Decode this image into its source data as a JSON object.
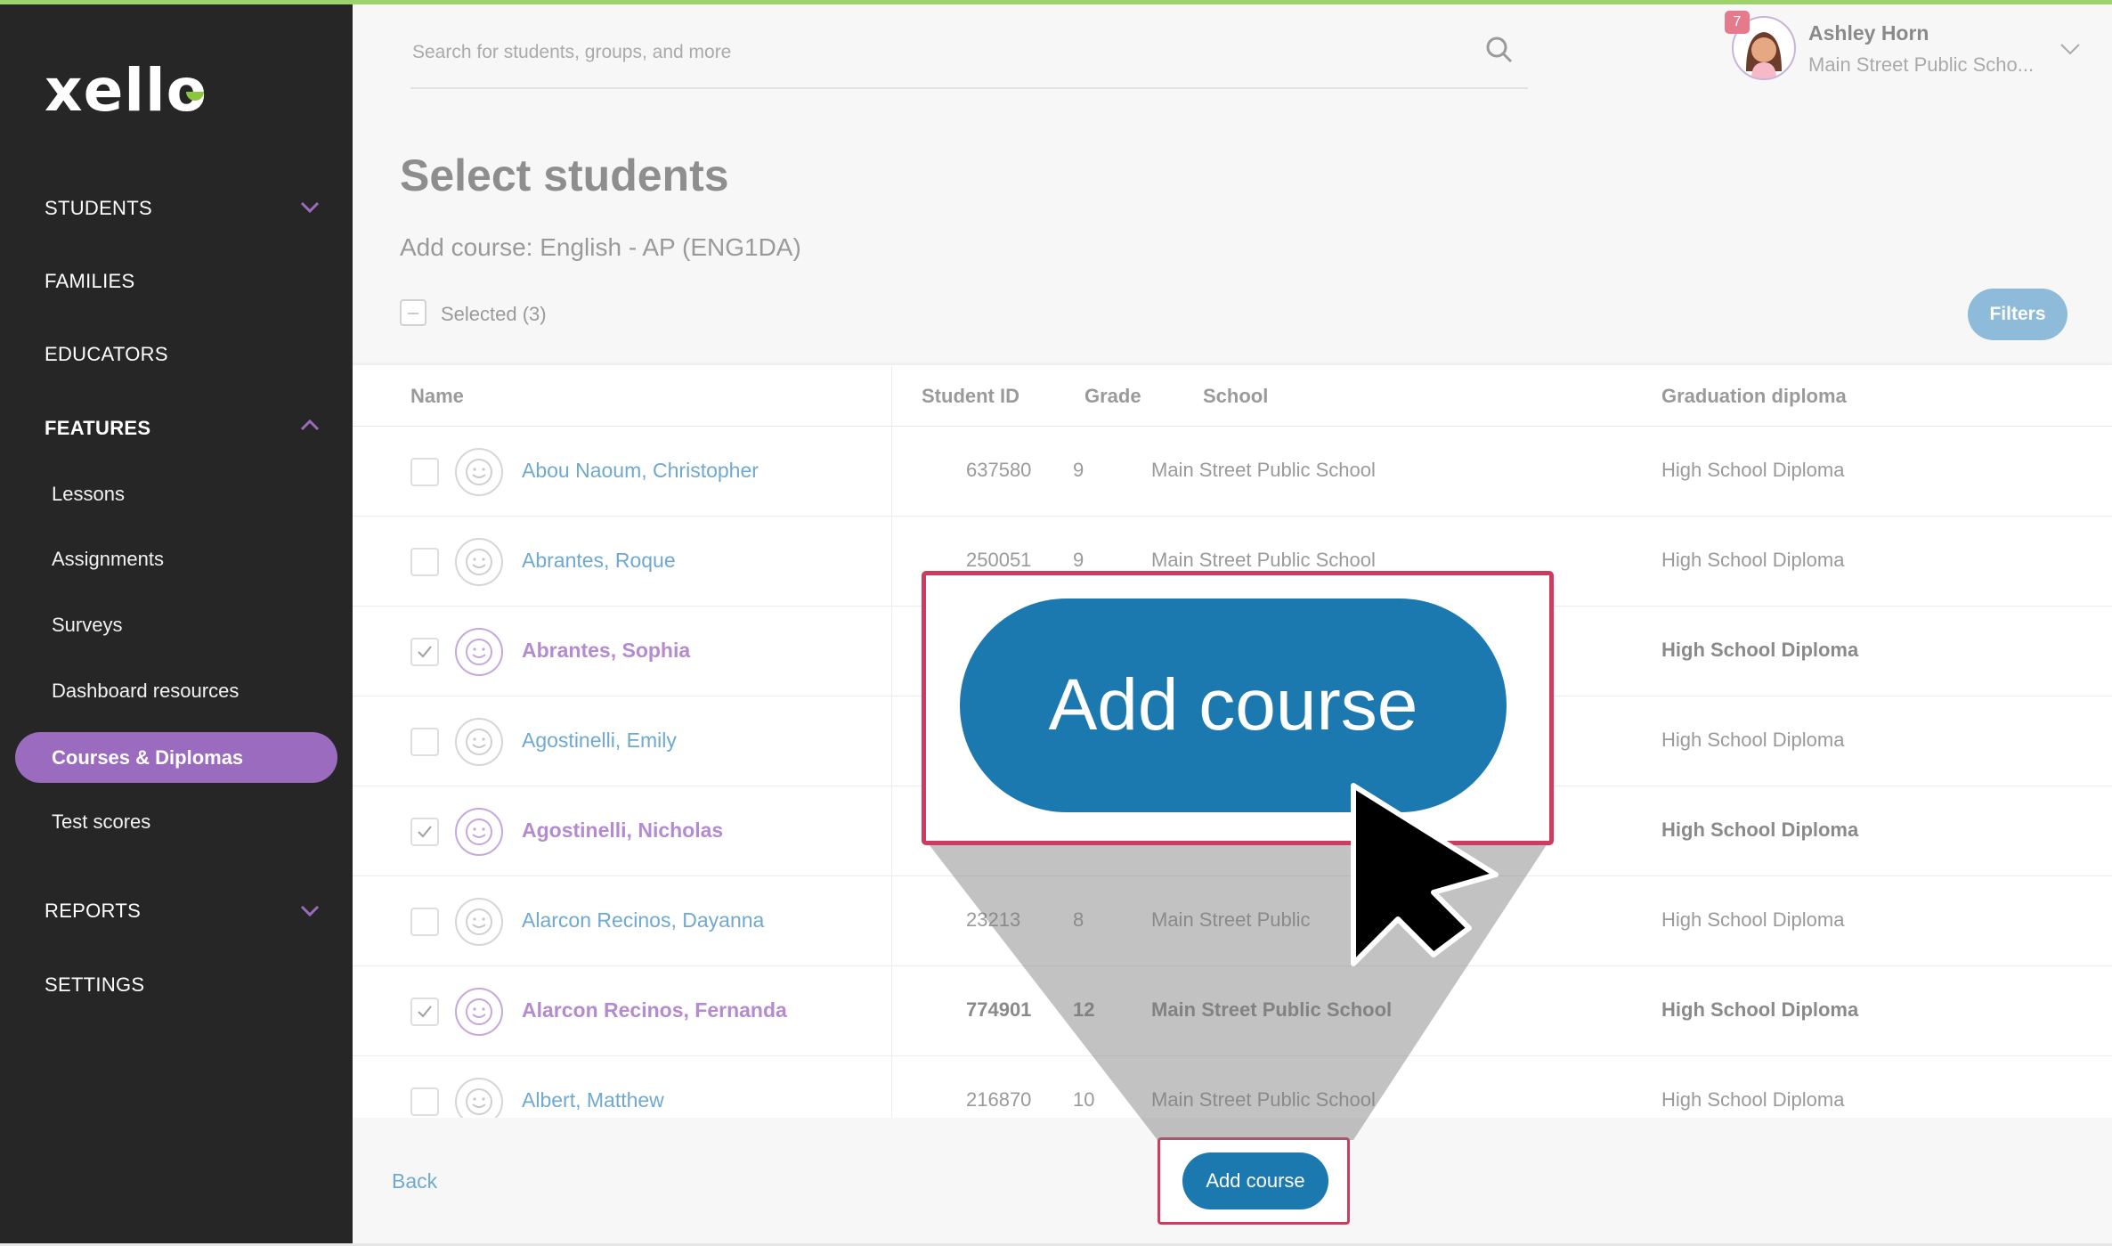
{
  "app": {
    "logo": "xello"
  },
  "sidebar": {
    "students": "STUDENTS",
    "families": "FAMILIES",
    "educators": "EDUCATORS",
    "features": "FEATURES",
    "features_items": [
      "Lessons",
      "Assignments",
      "Surveys",
      "Dashboard resources",
      "Courses & Diplomas",
      "Test scores"
    ],
    "reports": "REPORTS",
    "settings": "SETTINGS"
  },
  "header": {
    "search_placeholder": "Search for students, groups, and more",
    "user_name": "Ashley Horn",
    "user_school": "Main Street Public Scho...",
    "notification_count": "7"
  },
  "page": {
    "title": "Select students",
    "subtitle": "Add course: English - AP (ENG1DA)",
    "selected_label": "Selected (3)",
    "filters_label": "Filters"
  },
  "table": {
    "headers": [
      "Name",
      "Student ID",
      "Grade",
      "School",
      "Graduation diploma"
    ],
    "rows": [
      {
        "name": "Abou Naoum, Christopher",
        "id": "637580",
        "grade": "9",
        "school": "Main Street Public School",
        "diploma": "High School Diploma",
        "selected": false
      },
      {
        "name": "Abrantes, Roque",
        "id": "250051",
        "grade": "9",
        "school": "Main Street Public School",
        "diploma": "High School Diploma",
        "selected": false
      },
      {
        "name": "Abrantes, Sophia",
        "id": "",
        "grade": "",
        "school": "",
        "diploma": "High School Diploma",
        "selected": true
      },
      {
        "name": "Agostinelli, Emily",
        "id": "",
        "grade": "",
        "school": "",
        "diploma": "High School Diploma",
        "selected": false
      },
      {
        "name": "Agostinelli, Nicholas",
        "id": "",
        "grade": "",
        "school": "",
        "diploma": "High School Diploma",
        "selected": true
      },
      {
        "name": "Alarcon Recinos, Dayanna",
        "id": "23213",
        "grade": "8",
        "school": "Main Street Public",
        "diploma": "High School Diploma",
        "selected": false
      },
      {
        "name": "Alarcon Recinos, Fernanda",
        "id": "774901",
        "grade": "12",
        "school": "Main Street Public School",
        "diploma": "High School Diploma",
        "selected": true
      },
      {
        "name": "Albert, Matthew",
        "id": "216870",
        "grade": "10",
        "school": "Main Street Public School",
        "diploma": "High School Diploma",
        "selected": false
      }
    ]
  },
  "footer": {
    "back_label": "Back",
    "add_course_label": "Add course"
  },
  "callout": {
    "label": "Add course"
  },
  "colors": {
    "accent_purple": "#9b6bbf",
    "primary_blue": "#1b79b0",
    "highlight_red": "#cc3b60",
    "brand_green": "#8cc63f"
  }
}
